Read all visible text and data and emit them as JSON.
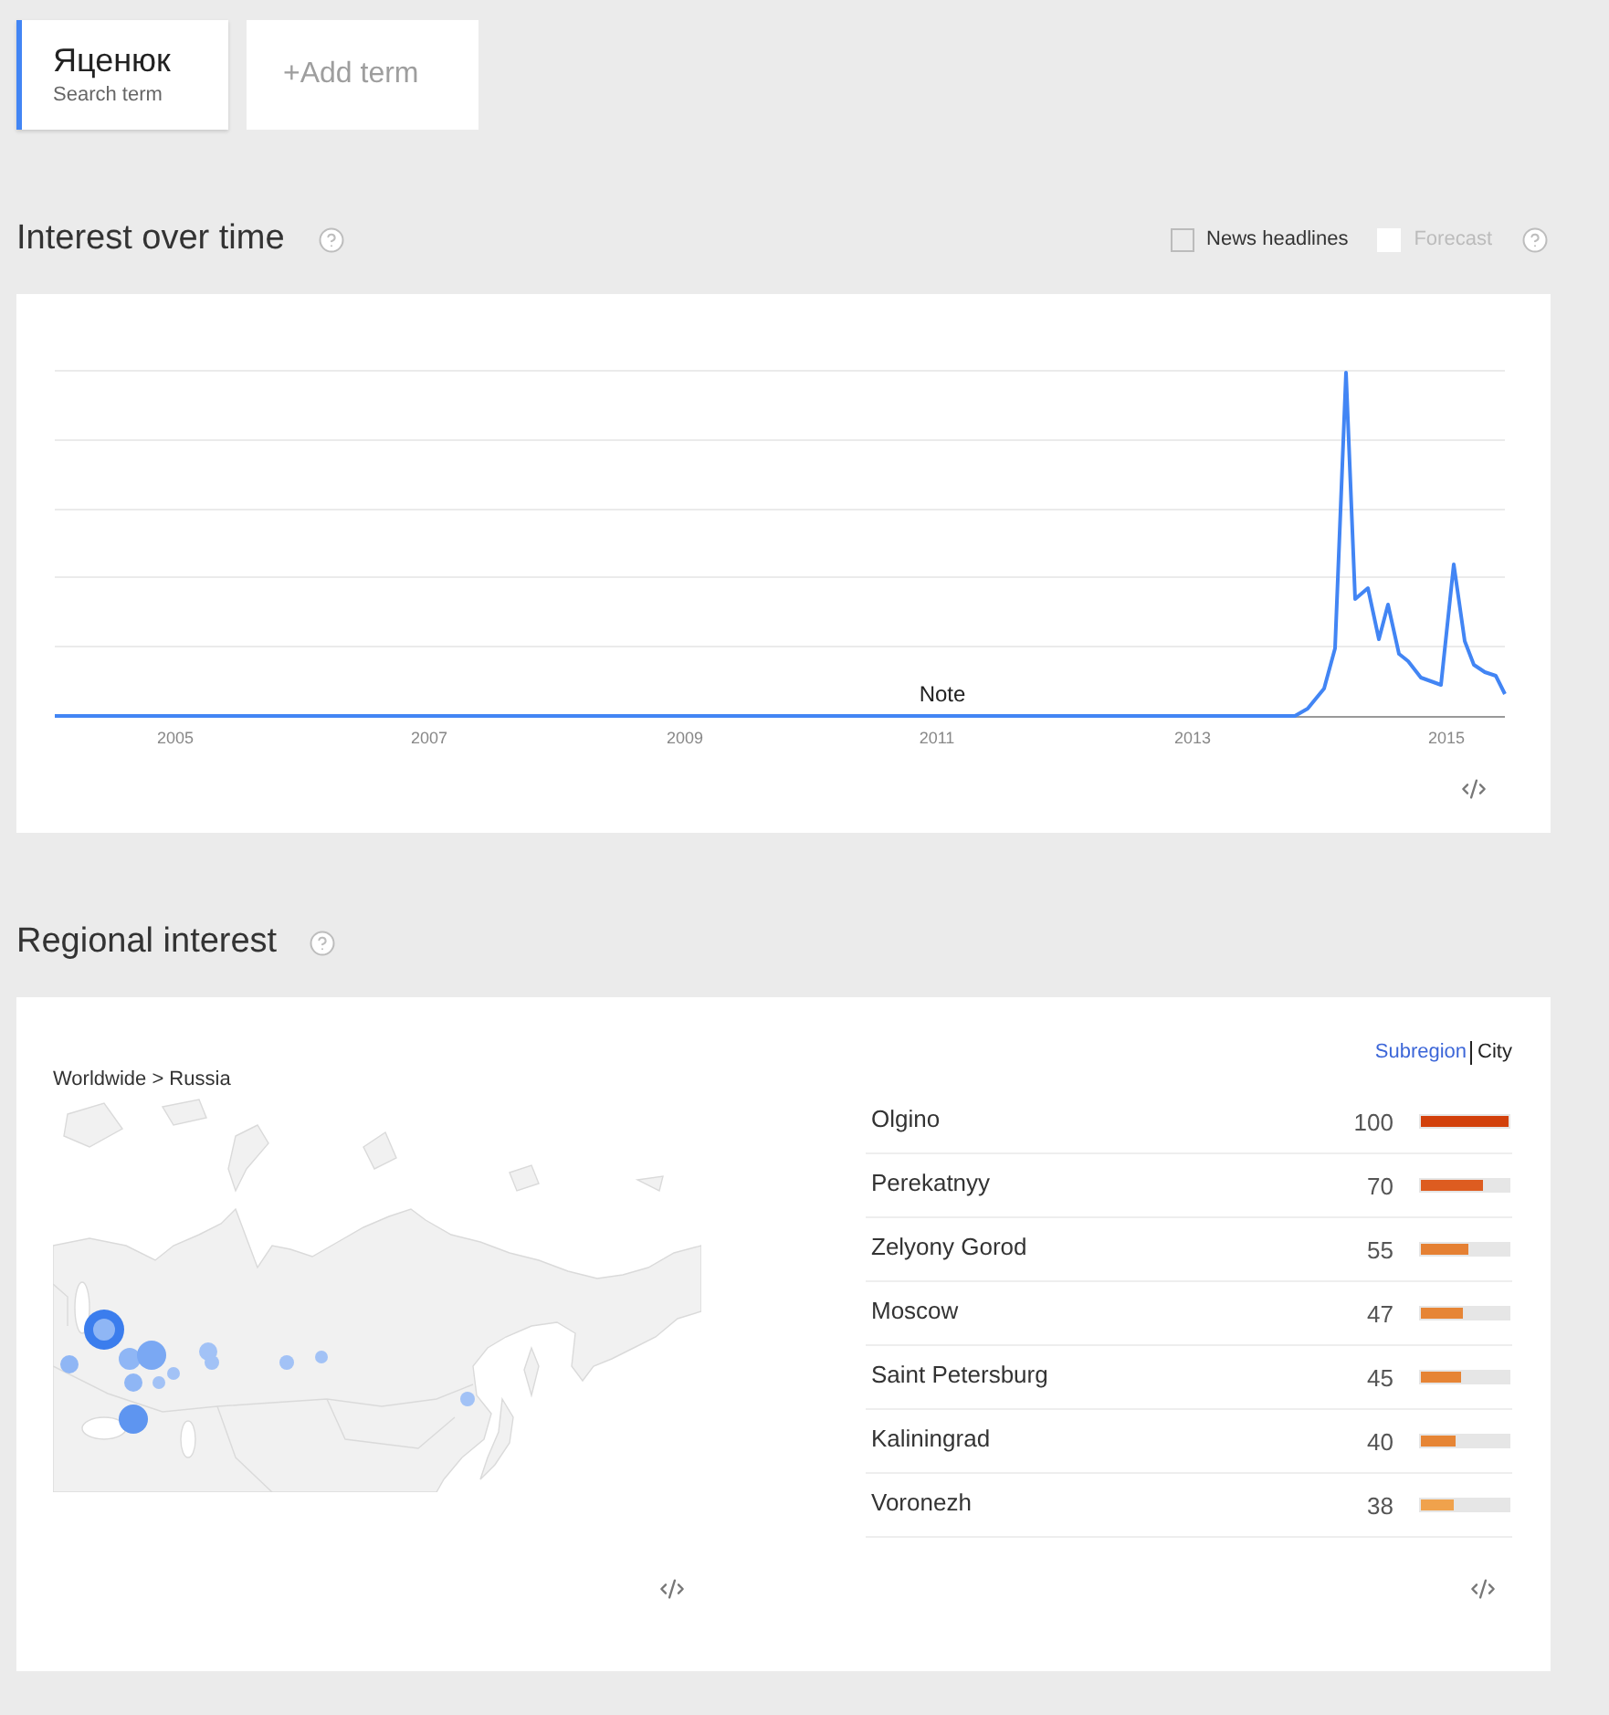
{
  "search_terms": [
    {
      "term": "Яценюк",
      "label": "Search term",
      "color": "#4285f4"
    }
  ],
  "add_term": {
    "label": "+Add term"
  },
  "interest_over_time": {
    "title": "Interest over time",
    "options": [
      {
        "label": "News headlines",
        "checked": false,
        "disabled": false
      },
      {
        "label": "Forecast",
        "checked": false,
        "disabled": true
      }
    ],
    "x_labels": [
      "2005",
      "2007",
      "2009",
      "2011",
      "2013",
      "2015"
    ],
    "note": "Note"
  },
  "regional_interest": {
    "title": "Regional interest",
    "breadcrumb": "Worldwide > Russia",
    "views": [
      {
        "label": "Subregion",
        "selected": false
      },
      {
        "label": "City",
        "selected": true
      }
    ],
    "rows": [
      {
        "name": "Olgino",
        "value": "100",
        "level": 1,
        "color": "#d2400b"
      },
      {
        "name": "Perekatnyy",
        "value": "70",
        "level": 0.7,
        "color": "#dd5c20"
      },
      {
        "name": "Zelyony Gorod",
        "value": "55",
        "level": 0.55,
        "color": "#e58033"
      },
      {
        "name": "Moscow",
        "value": "47",
        "level": 0.47,
        "color": "#e68536"
      },
      {
        "name": "Saint Petersburg",
        "value": "45",
        "level": 0.45,
        "color": "#e68435"
      },
      {
        "name": "Kaliningrad",
        "value": "40",
        "level": 0.4,
        "color": "#e68535"
      },
      {
        "name": "Voronezh",
        "value": "38",
        "level": 0.38,
        "color": "#f0a24c"
      }
    ]
  }
}
